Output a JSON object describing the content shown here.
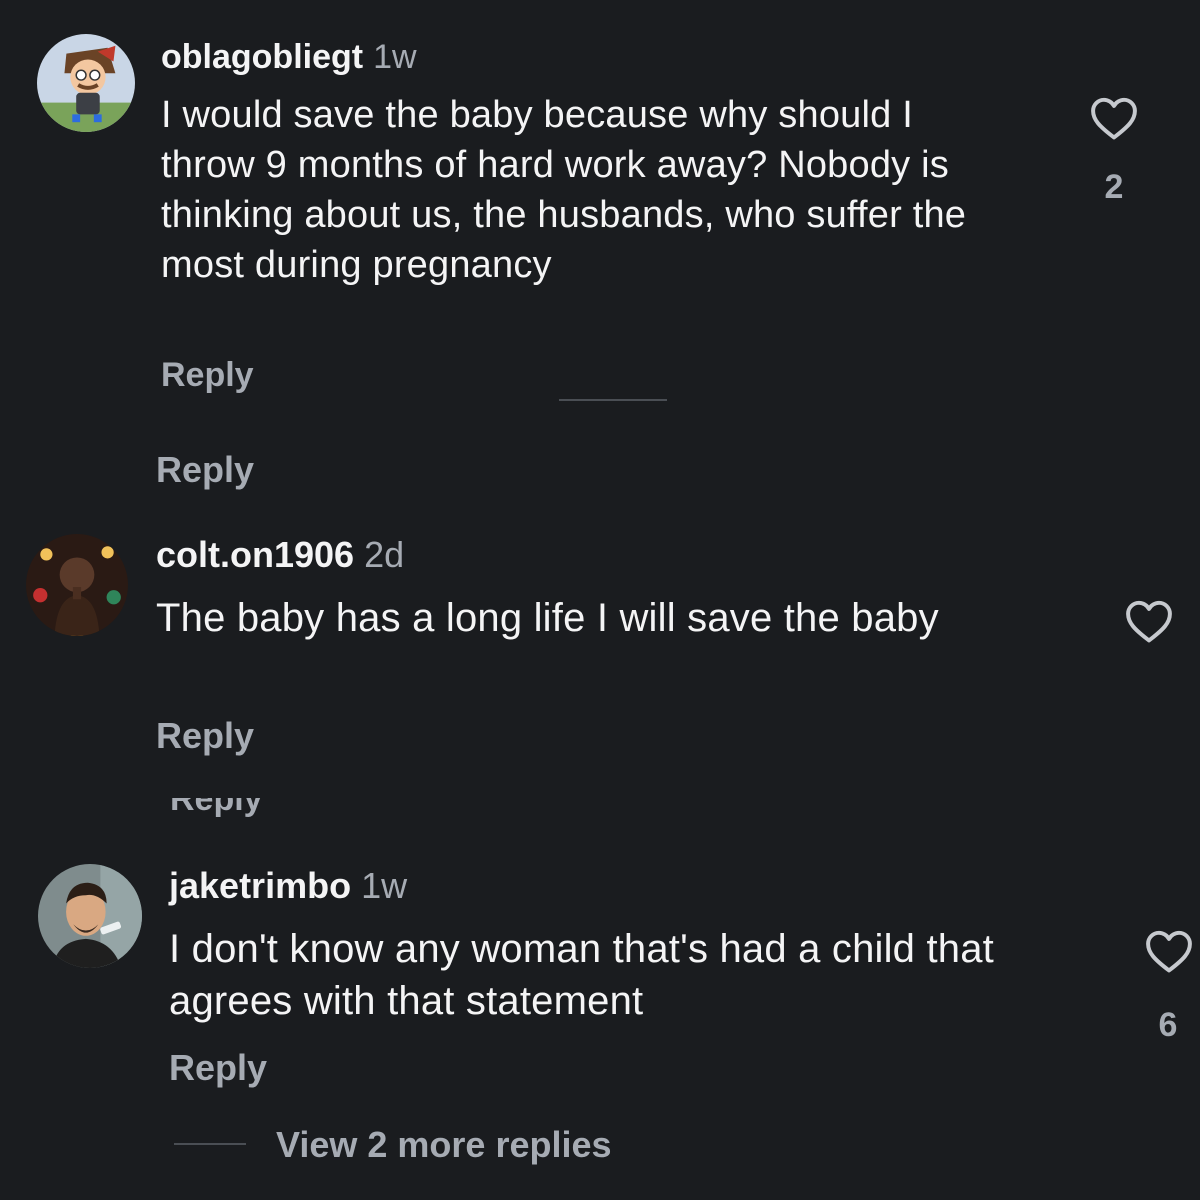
{
  "colors": {
    "background": "#1a1c1f",
    "primary_text": "#f4f4f5",
    "secondary_text": "#a6abb3",
    "divider": "#4a4e54"
  },
  "comments": [
    {
      "username": "oblagobliegt",
      "time": "1w",
      "text": "I would save the baby because why should I throw 9 months of hard work away? Nobody is thinking about us, the husbands, who suffer the most during pregnancy",
      "reply_label": "Reply",
      "like_count": "2",
      "icon": "heart-outline-icon"
    },
    {
      "username": "colt.on1906",
      "time": "2d",
      "text": "The baby has a long life I will save the baby",
      "reply_label": "Reply",
      "like_count": "",
      "icon": "heart-outline-icon"
    },
    {
      "username": "jaketrimbo",
      "time": "1w",
      "text": "I don't know any woman that's had a child that agrees with that statement",
      "reply_label": "Reply",
      "like_count": "6",
      "icon": "heart-outline-icon"
    }
  ],
  "stray_reply_label": "Reply",
  "clipped_reply_label": "Reply",
  "view_more_replies": "View 2 more replies"
}
